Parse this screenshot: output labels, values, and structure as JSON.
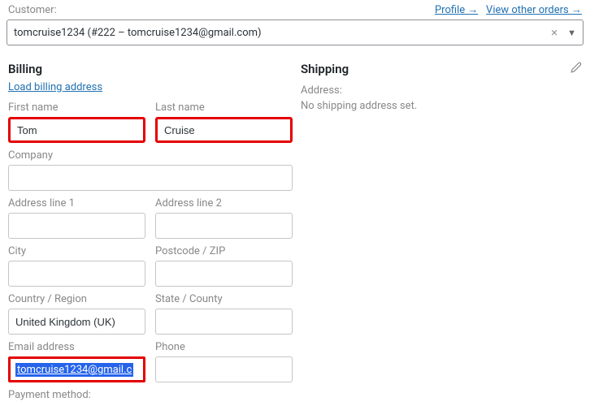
{
  "customer": {
    "label": "Customer:",
    "profile_link": "Profile →",
    "other_orders_link": "View other orders →",
    "value": "tomcruise1234 (#222 – tomcruise1234@gmail.com)"
  },
  "billing": {
    "title": "Billing",
    "load_link": "Load billing address",
    "first_name_label": "First name",
    "first_name_value": "Tom",
    "last_name_label": "Last name",
    "last_name_value": "Cruise",
    "company_label": "Company",
    "company_value": "",
    "address1_label": "Address line 1",
    "address1_value": "",
    "address2_label": "Address line 2",
    "address2_value": "",
    "city_label": "City",
    "city_value": "",
    "postcode_label": "Postcode / ZIP",
    "postcode_value": "",
    "country_label": "Country / Region",
    "country_value": "United Kingdom (UK)",
    "state_label": "State / County",
    "state_value": "",
    "email_label": "Email address",
    "email_value": "tomcruise1234@gmail.c",
    "phone_label": "Phone",
    "phone_value": "",
    "payment_label": "Payment method:"
  },
  "shipping": {
    "title": "Shipping",
    "address_label": "Address:",
    "none_text": "No shipping address set."
  }
}
